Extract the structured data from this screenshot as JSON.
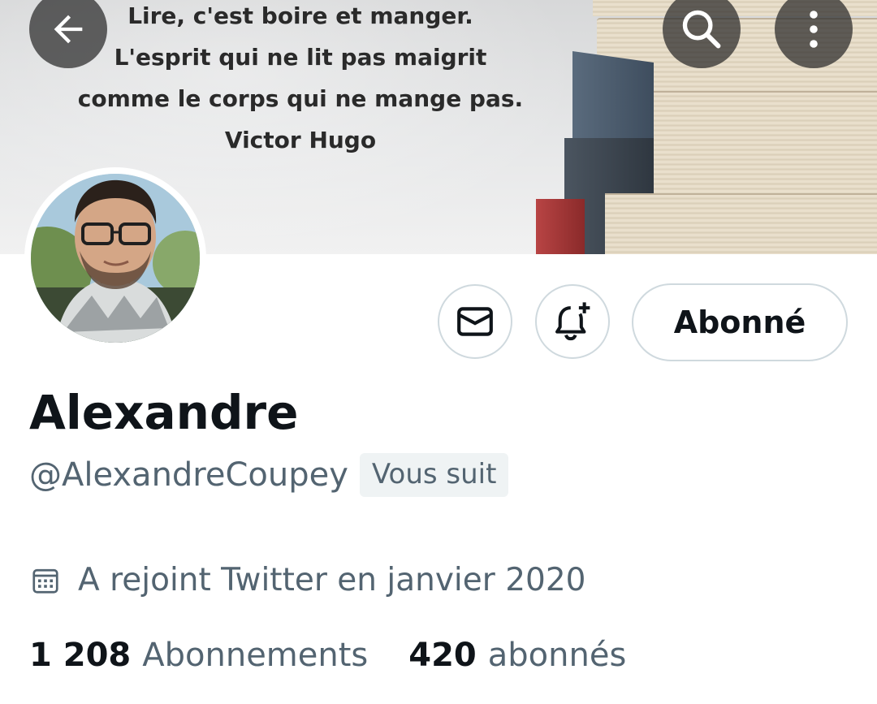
{
  "header": {
    "banner_quote": [
      "Lire, c'est boire et manger.",
      "L'esprit qui ne lit pas maigrit",
      "comme le corps qui ne mange pas.",
      "Victor Hugo"
    ],
    "back_icon": "arrow-left-icon",
    "search_icon": "search-icon",
    "more_icon": "more-vertical-icon"
  },
  "actions": {
    "message_icon": "envelope-icon",
    "notify_icon": "bell-plus-icon",
    "follow_label": "Abonné"
  },
  "profile": {
    "name": "Alexandre",
    "handle": "@AlexandreCoupey",
    "follows_you": "Vous suit",
    "joined": "A rejoint Twitter en janvier 2020",
    "joined_icon": "calendar-icon"
  },
  "stats": {
    "following_count": "1 208",
    "following_label": "Abonnements",
    "followers_count": "420",
    "followers_label": "abonnés"
  },
  "colors": {
    "text_primary": "#0f1419",
    "text_secondary": "#536471",
    "border": "#cfd9de",
    "badge_bg": "#eff3f4"
  }
}
